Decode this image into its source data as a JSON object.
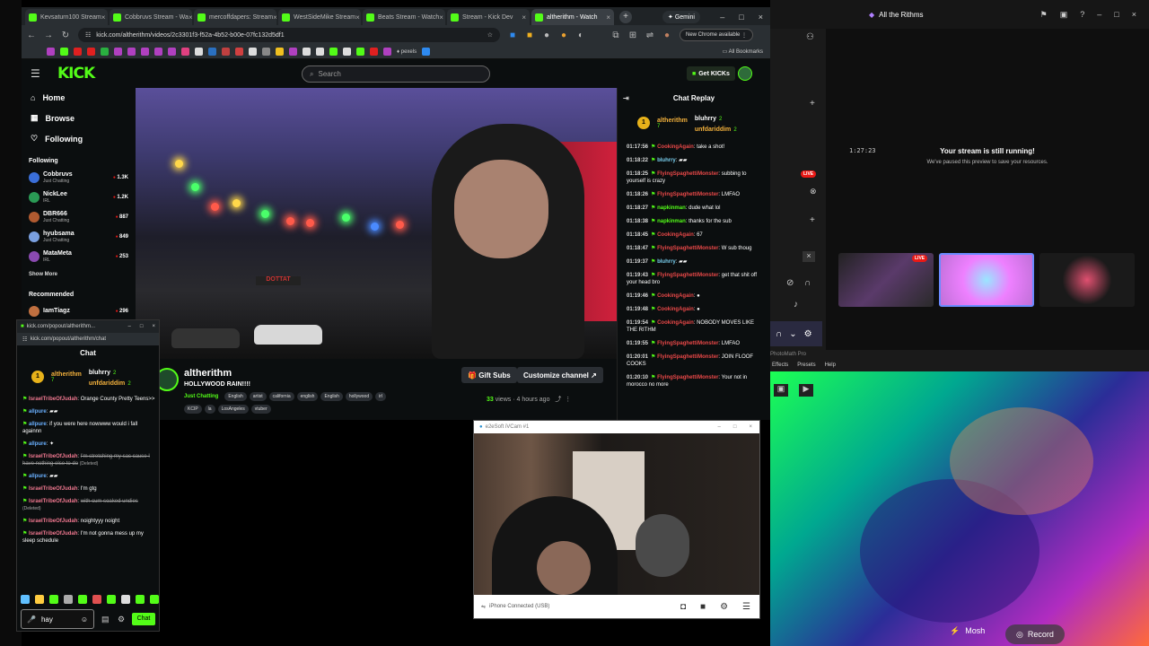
{
  "browser": {
    "tabs": [
      {
        "label": "Kevsaturn100 Stream"
      },
      {
        "label": "Cobbruvs Stream - Wa"
      },
      {
        "label": "mercoffdapers: Stream"
      },
      {
        "label": "WestSideMike Stream"
      },
      {
        "label": "Beats Stream - Watch"
      },
      {
        "label": "Stream - Kick Dev"
      },
      {
        "label": "altherithm - Watch"
      }
    ],
    "gemini_label": "Gemini",
    "url": "kick.com/altherithm/videos/2c3301f3-f52a-4b52-b00e-07fc132d5df1",
    "chrome_available": "New Chrome available",
    "bookmarks_pexels": "pexels",
    "all_bookmarks": "All Bookmarks"
  },
  "kick": {
    "logo": "KICK",
    "search_placeholder": "Search",
    "get_kicks": "Get KICKs",
    "nav": [
      {
        "label": "Home",
        "icon": "⌂"
      },
      {
        "label": "Browse",
        "icon": "▦"
      },
      {
        "label": "Following",
        "icon": "♡"
      }
    ],
    "following_header": "Following",
    "following": [
      {
        "name": "Cobbruvs",
        "sub": "Just Chatting",
        "viewers": "1.3K",
        "color": "#3a6ed8"
      },
      {
        "name": "NickLee",
        "sub": "IRL",
        "viewers": "1.2K",
        "color": "#2a9a55"
      },
      {
        "name": "DBR666",
        "sub": "Just Chatting",
        "viewers": "887",
        "color": "#b05a30"
      },
      {
        "name": "hyubsama",
        "sub": "Just Chatting",
        "viewers": "849",
        "color": "#7aa0e0"
      },
      {
        "name": "MataMeta",
        "sub": "IRL",
        "viewers": "253",
        "color": "#8a4ab0"
      }
    ],
    "show_more": "Show More",
    "recommended_header": "Recommended",
    "recommended": [
      {
        "name": "IamTiagz",
        "viewers": "296",
        "color": "#c07040"
      }
    ],
    "video": {
      "sign_text": "DOTTAT",
      "channel": "altherithm",
      "title": "HOLLYWOOD RAIN!!!!",
      "category": "Just Chatting",
      "tags_row1": [
        "English",
        "artist",
        "california",
        "english",
        "English",
        "hollywood",
        "irl"
      ],
      "tags_row2": [
        "KCIP",
        "la",
        "LosAngeles",
        "vtuber"
      ],
      "gift_subs": "Gift Subs",
      "customize": "Customize channel",
      "views_count": "33",
      "views_label": "views",
      "ago": "4 hours ago"
    },
    "chat_replay": {
      "title": "Chat Replay",
      "top_gifter": {
        "name": "altherithm",
        "count": "7",
        "badge": "1"
      },
      "gifters": [
        {
          "name": "bluhrry",
          "count": "2"
        },
        {
          "name": "unfdariddim",
          "count": "2"
        }
      ],
      "messages": [
        {
          "time": "01:17:56",
          "user": "CookingAgain",
          "color": "#e94848",
          "text": "take a shot!"
        },
        {
          "time": "01:18:22",
          "user": "bluhrry",
          "color": "#7ad0f0",
          "text": "▰▰"
        },
        {
          "time": "01:18:25",
          "user": "FlyingSpaghettiMonster",
          "color": "#e94848",
          "text": "subbing to yourself is crazy"
        },
        {
          "time": "01:18:26",
          "user": "FlyingSpaghettiMonster",
          "color": "#e94848",
          "text": "LMFAO"
        },
        {
          "time": "01:18:27",
          "user": "napkinman",
          "color": "#53fc18",
          "text": "dude what lol"
        },
        {
          "time": "01:18:38",
          "user": "napkinman",
          "color": "#53fc18",
          "text": "thanks for the sub"
        },
        {
          "time": "01:18:45",
          "user": "CookingAgain",
          "color": "#e94848",
          "text": "67"
        },
        {
          "time": "01:18:47",
          "user": "FlyingSpaghettiMonster",
          "color": "#e94848",
          "text": "W sub thoug"
        },
        {
          "time": "01:19:37",
          "user": "bluhrry",
          "color": "#7ad0f0",
          "text": "▰▰"
        },
        {
          "time": "01:19:43",
          "user": "FlyingSpaghettiMonster",
          "color": "#e94848",
          "text": "get that shit off your head bro"
        },
        {
          "time": "01:19:46",
          "user": "CookingAgain",
          "color": "#e94848",
          "text": "●"
        },
        {
          "time": "01:19:48",
          "user": "CookingAgain",
          "color": "#e94848",
          "text": "●"
        },
        {
          "time": "01:19:54",
          "user": "CookingAgain",
          "color": "#e94848",
          "text": "NOBODY MOVES LIKE THE RITHM"
        },
        {
          "time": "01:19:55",
          "user": "FlyingSpaghettiMonster",
          "color": "#e94848",
          "text": "LMFAO"
        },
        {
          "time": "01:20:01",
          "user": "FlyingSpaghettiMonster",
          "color": "#e94848",
          "text": "JOIN FLOOF COOKS"
        },
        {
          "time": "01:20:10",
          "user": "FlyingSpaghettiMonster",
          "color": "#e94848",
          "text": "Your not in morocco no more"
        }
      ]
    }
  },
  "popout": {
    "window_title": "kick.com/popout/altherithm...",
    "url": "kick.com/popout/altherithm/chat",
    "chat_header": "Chat",
    "top_gifter": {
      "name": "altherithm",
      "count": "7",
      "badge": "1"
    },
    "gifters": [
      {
        "name": "bluhrry",
        "count": "2"
      },
      {
        "name": "unfdariddim",
        "count": "2"
      }
    ],
    "messages": [
      {
        "user": "IsraelTribeOfJudah",
        "color": "#f07890",
        "text": "Orange County Pretty Teens>>",
        "deleted": ""
      },
      {
        "user": "allpure",
        "color": "#6ab0ff",
        "text": "▰▰",
        "deleted": ""
      },
      {
        "user": "allpure",
        "color": "#6ab0ff",
        "text": "if you were here nowwww would i fall againnn",
        "deleted": ""
      },
      {
        "user": "allpure",
        "color": "#6ab0ff",
        "text": "✦",
        "deleted": ""
      },
      {
        "user": "IsraelTribeOfJudah",
        "color": "#f07890",
        "text": "I'm stretching my sac cause I have nothing else to do",
        "deleted": "(Deleted)"
      },
      {
        "user": "allpure",
        "color": "#6ab0ff",
        "text": "▰▰",
        "deleted": ""
      },
      {
        "user": "IsraelTribeOfJudah",
        "color": "#f07890",
        "text": "I'm gtg",
        "deleted": ""
      },
      {
        "user": "IsraelTribeOfJudah",
        "color": "#f07890",
        "text": "with cum soaked undies",
        "deleted": "(Deleted)"
      },
      {
        "user": "IsraelTribeOfJudah",
        "color": "#f07890",
        "text": "noightyyy noight",
        "deleted": ""
      },
      {
        "user": "IsraelTribeOfJudah",
        "color": "#f07890",
        "text": "I'm not gonna mess up my sleep schedule",
        "deleted": ""
      }
    ],
    "input_value": "hay",
    "chat_button": "Chat"
  },
  "stream_app": {
    "title": "All the Rithms",
    "timecode": "1:27:23",
    "live_badge": "LIVE",
    "still_running": "Your stream is still running!",
    "paused_text": "We've paused this preview to save your resources."
  },
  "photomath": {
    "title": "PhotoMath Pro",
    "menu": [
      "Effects",
      "Presets",
      "Help"
    ]
  },
  "camera_app": {
    "mosh_label": "Mosh",
    "record_label": "Record"
  },
  "iphone_window": {
    "title": "e2eSoft iVCam #1",
    "status": "iPhone Connected (USB)"
  }
}
